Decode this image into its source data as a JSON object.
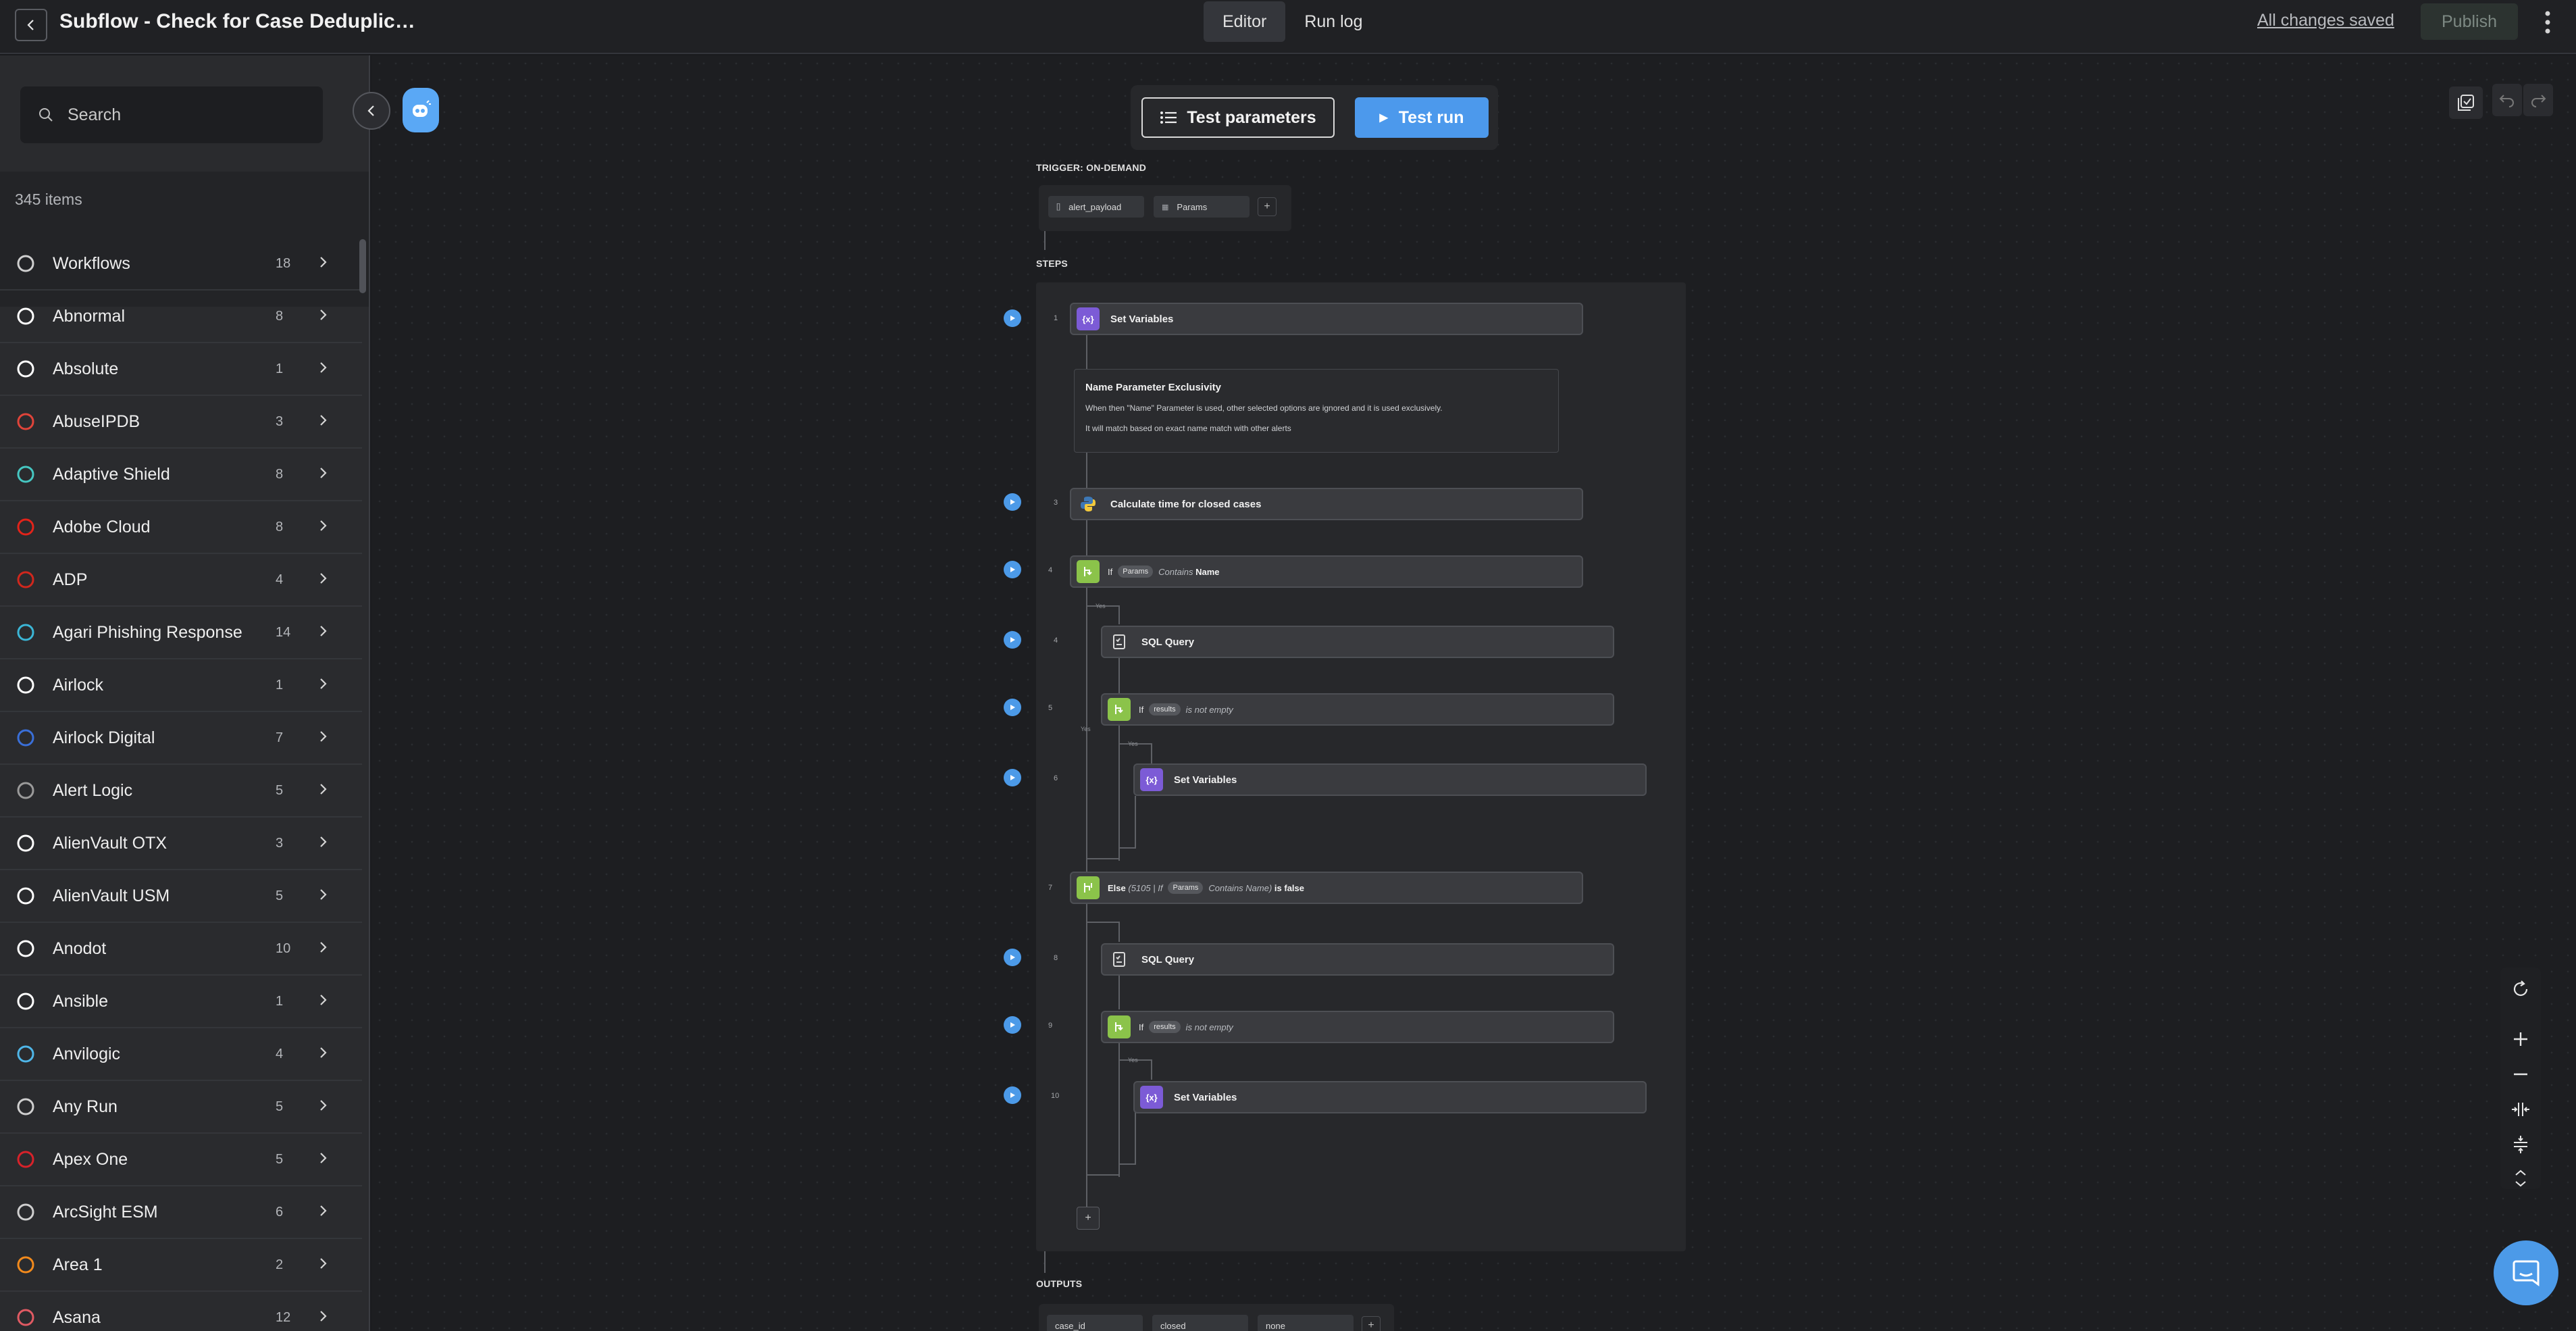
{
  "header": {
    "title": "Subflow - Check for Case Deduplic…",
    "tabs": [
      {
        "label": "Editor",
        "active": true
      },
      {
        "label": "Run log",
        "active": false
      }
    ],
    "save_status": "All changes saved",
    "publish_label": "Publish"
  },
  "sidebar": {
    "search_placeholder": "Search",
    "count_label": "345 items",
    "items": [
      {
        "name": "Workflows",
        "count": "18",
        "icon": "workflows-icon",
        "color": "#cfcfcf"
      },
      {
        "name": "Abnormal",
        "count": "8",
        "icon": "abnormal-logo-icon",
        "color": "#ffffff"
      },
      {
        "name": "Absolute",
        "count": "1",
        "icon": "absolute-logo-icon",
        "color": "#ffffff"
      },
      {
        "name": "AbuseIPDB",
        "count": "3",
        "icon": "abuseipdb-logo-icon",
        "color": "#e0443a"
      },
      {
        "name": "Adaptive Shield",
        "count": "8",
        "icon": "adaptive-shield-logo-icon",
        "color": "#46c7c2"
      },
      {
        "name": "Adobe Cloud",
        "count": "8",
        "icon": "adobe-logo-icon",
        "color": "#e2231a"
      },
      {
        "name": "ADP",
        "count": "4",
        "icon": "adp-logo-icon",
        "color": "#d0271d"
      },
      {
        "name": "Agari Phishing Response",
        "count": "14",
        "icon": "agari-logo-icon",
        "color": "#3bb6d6"
      },
      {
        "name": "Airlock",
        "count": "1",
        "icon": "airlock-logo-icon",
        "color": "#ffffff"
      },
      {
        "name": "Airlock Digital",
        "count": "7",
        "icon": "airlock-digital-logo-icon",
        "color": "#3a6fd8"
      },
      {
        "name": "Alert Logic",
        "count": "5",
        "icon": "alert-logic-logo-icon",
        "color": "#9a9a9a"
      },
      {
        "name": "AlienVault OTX",
        "count": "3",
        "icon": "alienvault-otx-logo-icon",
        "color": "#ffffff"
      },
      {
        "name": "AlienVault USM",
        "count": "5",
        "icon": "alienvault-usm-logo-icon",
        "color": "#ffffff"
      },
      {
        "name": "Anodot",
        "count": "10",
        "icon": "anodot-logo-icon",
        "color": "#ffffff"
      },
      {
        "name": "Ansible",
        "count": "1",
        "icon": "ansible-logo-icon",
        "color": "#ffffff"
      },
      {
        "name": "Anvilogic",
        "count": "4",
        "icon": "anvilogic-logo-icon",
        "color": "#4fb6e8"
      },
      {
        "name": "Any Run",
        "count": "5",
        "icon": "any-run-logo-icon",
        "color": "#cfcfcf"
      },
      {
        "name": "Apex One",
        "count": "5",
        "icon": "apex-one-logo-icon",
        "color": "#d7222a"
      },
      {
        "name": "ArcSight ESM",
        "count": "6",
        "icon": "arcsight-logo-icon",
        "color": "#cfcfcf"
      },
      {
        "name": "Area 1",
        "count": "2",
        "icon": "area1-logo-icon",
        "color": "#f28a1c"
      },
      {
        "name": "Asana",
        "count": "12",
        "icon": "asana-logo-icon",
        "color": "#e05a63"
      }
    ]
  },
  "toolbar": {
    "test_parameters_label": "Test parameters",
    "test_run_label": "Test run"
  },
  "flow": {
    "trigger_label": "TRIGGER: ON-DEMAND",
    "trigger_chip_1": "alert_payload",
    "trigger_chip_1_type": "[]",
    "trigger_chip_2": "Params",
    "trigger_add": "+",
    "steps_label": "STEPS",
    "steps": [
      {
        "no": "1",
        "label": "Set Variables"
      },
      {
        "no": "3",
        "label": "Calculate time for closed cases"
      },
      {
        "no": "4",
        "label": "If",
        "pill": "Params",
        "op": "Contains",
        "value": "Name"
      },
      {
        "no": "4",
        "label": "SQL Query"
      },
      {
        "no": "5",
        "label": "If",
        "pill": "results",
        "op": "is not empty"
      },
      {
        "no": "6",
        "label": "Set Variables"
      },
      {
        "no": "7",
        "label": "Else",
        "else_text": "(5105 | If",
        "pill": "Params",
        "op": "Contains Name)",
        "value": "is false"
      },
      {
        "no": "8",
        "label": "SQL Query"
      },
      {
        "no": "9",
        "label": "If",
        "pill": "results",
        "op": "is not empty"
      },
      {
        "no": "10",
        "label": "Set Variables"
      }
    ],
    "note": {
      "title": "Name Parameter Exclusivity",
      "line1": "When then \"Name\" Parameter is used, other selected options are ignored and it is used exclusively.",
      "line2": "It will match based on exact name match with other alerts"
    },
    "yes_label": "Yes",
    "add_step": "+",
    "outputs_label": "OUTPUTS",
    "outputs": [
      "case_id",
      "closed",
      "none"
    ],
    "outputs_add": "+"
  },
  "colors": {
    "accent": "#4c99ec",
    "set_variables": "#7c5bd6",
    "condition": "#8bc34a"
  }
}
